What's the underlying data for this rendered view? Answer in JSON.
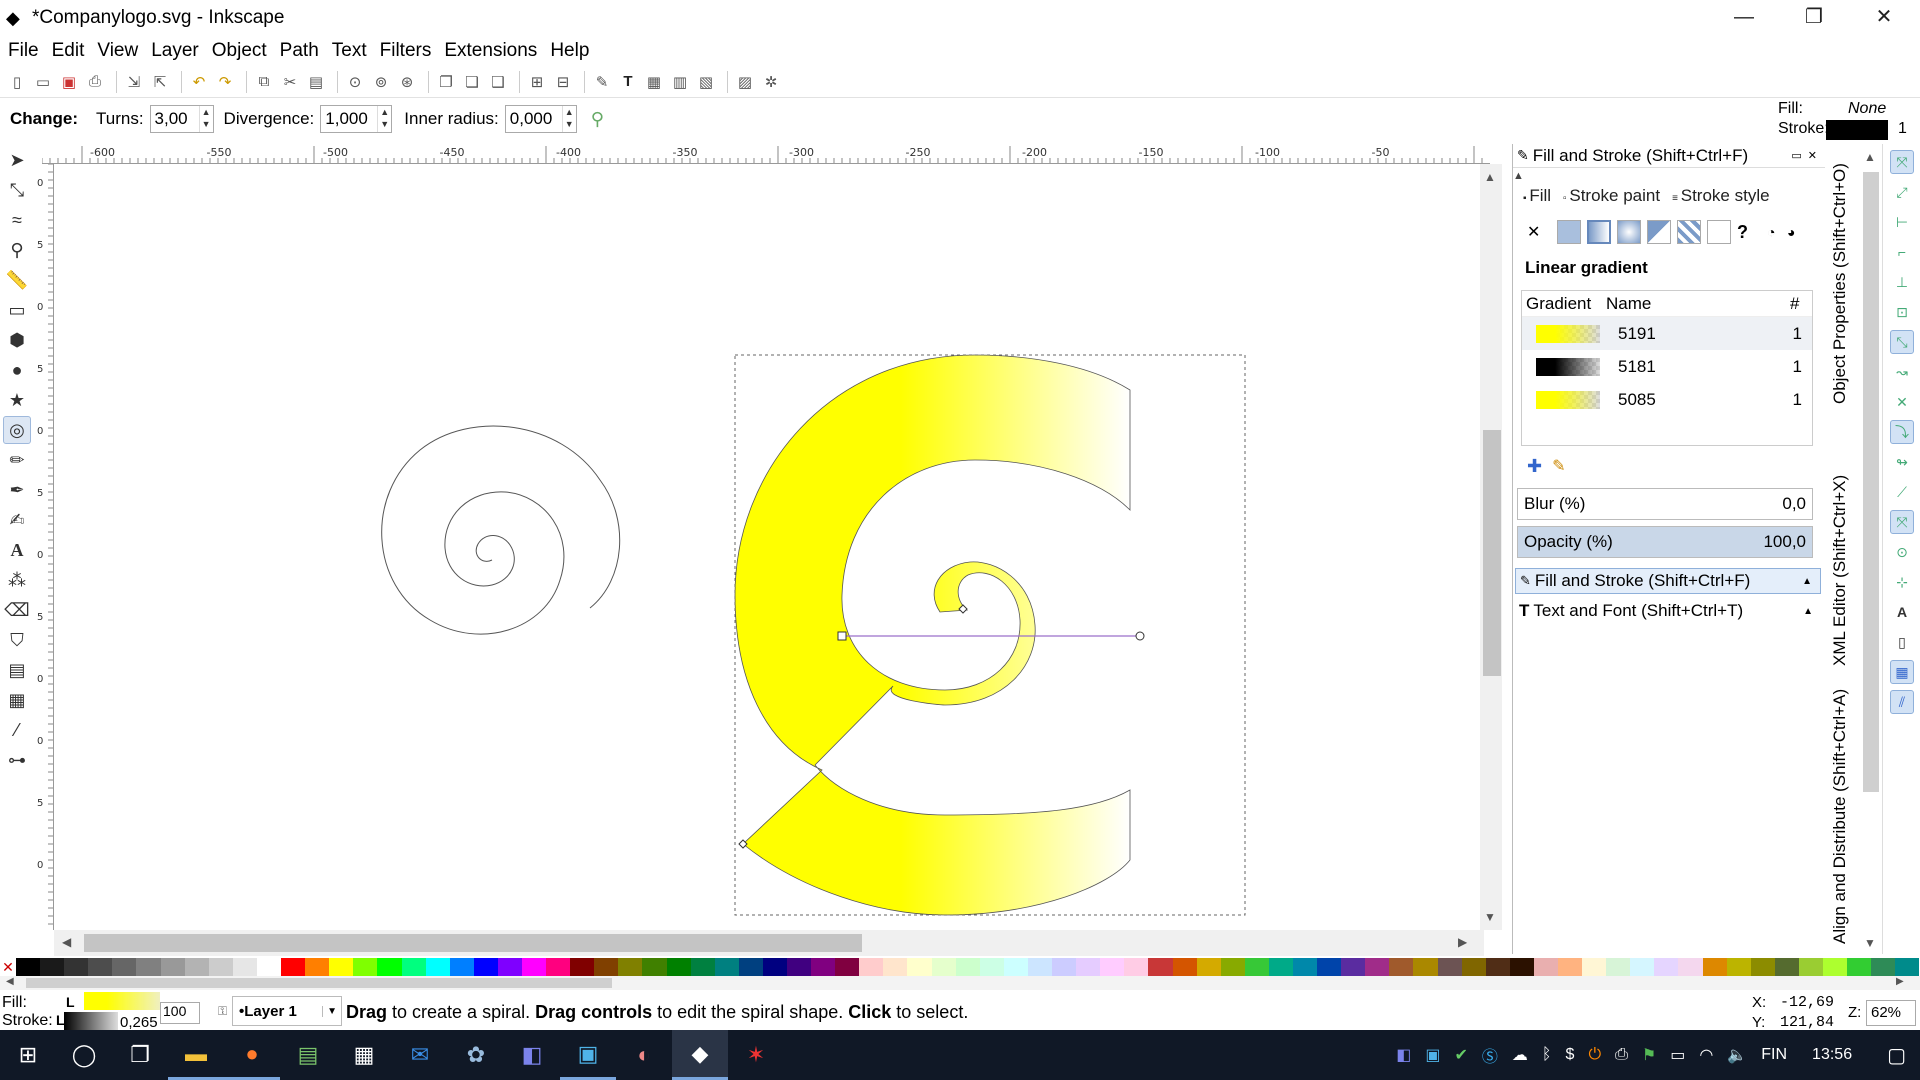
{
  "window": {
    "title": "*Companylogo.svg - Inkscape",
    "minimize": "—",
    "restore": "❐",
    "close": "✕"
  },
  "menu": [
    "File",
    "Edit",
    "View",
    "Layer",
    "Object",
    "Path",
    "Text",
    "Filters",
    "Extensions",
    "Help"
  ],
  "controls": {
    "change_label": "Change:",
    "turns_label": "Turns:",
    "turns_value": "3,00",
    "divergence_label": "Divergence:",
    "divergence_value": "1,000",
    "inner_radius_label": "Inner radius:",
    "inner_radius_value": "0,000"
  },
  "style_indicator": {
    "fill_label": "Fill:",
    "fill_value": "None",
    "stroke_label": "Stroke:",
    "stroke_width": "1"
  },
  "ruler_labels": [
    "-600",
    "-550",
    "-500",
    "-450",
    "-400",
    "-350",
    "-300",
    "-250",
    "-200",
    "-150",
    "-100",
    "-50"
  ],
  "left_ruler_labels": [
    "0",
    "5",
    "0",
    "5",
    "0",
    "5",
    "0",
    "5",
    "0",
    "0",
    "5",
    "0"
  ],
  "panel": {
    "title": "Fill and Stroke (Shift+Ctrl+F)",
    "tabs": [
      "Fill",
      "Stroke paint",
      "Stroke style"
    ],
    "gradient_type": "Linear gradient",
    "col_gradient": "Gradient",
    "col_name": "Name",
    "col_count": "#",
    "gradients": [
      {
        "name": "5191",
        "count": "1",
        "color": "#ffff00"
      },
      {
        "name": "5181",
        "count": "1",
        "color": "#000000"
      },
      {
        "name": "5085",
        "count": "1",
        "color": "#ffff00"
      }
    ],
    "blur_label": "Blur (%)",
    "blur_value": "0,0",
    "opacity_label": "Opacity (%)",
    "opacity_value": "100,0",
    "opacity_fraction": 1.0,
    "docked": [
      {
        "label": "Fill and Stroke (Shift+Ctrl+F)"
      },
      {
        "label": "Text and Font (Shift+Ctrl+T)"
      }
    ]
  },
  "vertical_tabs": [
    "Object Properties (Shift+Ctrl+O)",
    "XML Editor (Shift+Ctrl+X)",
    "Align and Distribute (Shift+Ctrl+A)"
  ],
  "status": {
    "fill_label": "Fill:",
    "fill_flag": "L",
    "stroke_label": "Stroke:",
    "stroke_flag": "L",
    "stroke_width": "0,265",
    "opacity_value": "100",
    "layer": "•Layer 1",
    "msg_1": "Drag",
    "msg_2": " to create a spiral. ",
    "msg_3": "Drag controls",
    "msg_4": " to edit the spiral shape. ",
    "msg_5": "Click",
    "msg_6": " to select.",
    "x_label": "X:",
    "x_value": "-12,69",
    "y_label": "Y:",
    "y_value": "121,84",
    "zoom_label": "Z:",
    "zoom_value": "62%"
  },
  "taskbar": {
    "language": "FIN",
    "time": "13:56"
  },
  "palette": [
    "#000000",
    "#1a1a1a",
    "#333333",
    "#4d4d4d",
    "#666666",
    "#808080",
    "#999999",
    "#b3b3b3",
    "#cccccc",
    "#e6e6e6",
    "#ffffff",
    "#ff0000",
    "#ff7f00",
    "#ffff00",
    "#7fff00",
    "#00ff00",
    "#00ff7f",
    "#00ffff",
    "#007fff",
    "#0000ff",
    "#7f00ff",
    "#ff00ff",
    "#ff007f",
    "#800000",
    "#804000",
    "#808000",
    "#408000",
    "#008000",
    "#008040",
    "#008080",
    "#004080",
    "#000080",
    "#400080",
    "#800080",
    "#800040",
    "#ffcccc",
    "#ffe5cc",
    "#ffffcc",
    "#e5ffcc",
    "#ccffcc",
    "#ccffe5",
    "#ccffff",
    "#cce5ff",
    "#ccccff",
    "#e5ccff",
    "#ffccff",
    "#ffcce5",
    "#c83737",
    "#d45500",
    "#d4aa00",
    "#88aa00",
    "#37c837",
    "#00aa88",
    "#0088aa",
    "#0044aa",
    "#5a2ca0",
    "#a02c89",
    "#a05a2c",
    "#aa8800",
    "#6c5353",
    "#806600",
    "#502d16",
    "#2b1100",
    "#e9afaf",
    "#ffb380",
    "#fff6d5",
    "#d7f4d7",
    "#d5f6ff",
    "#e5d5ff",
    "#f4d7ee",
    "#dd8800",
    "#bcb400",
    "#8c8c00",
    "#556b2f",
    "#9acd32",
    "#adff2f",
    "#32cd32",
    "#2e8b57",
    "#008b8b"
  ]
}
